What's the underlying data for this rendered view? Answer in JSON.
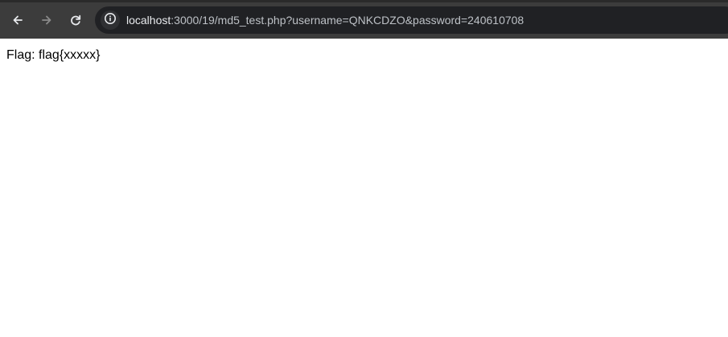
{
  "browser": {
    "back_icon": "arrow-left-icon",
    "forward_icon": "arrow-right-icon",
    "reload_icon": "reload-icon",
    "site_info_icon": "info-icon",
    "url_host": "localhost",
    "url_path": ":3000/19/md5_test.php?username=QNKCDZO&password=240610708"
  },
  "page": {
    "text": "Flag: flag{xxxxx}"
  },
  "colors": {
    "toolbar": "#3c3c3c",
    "omnibox": "#202124",
    "page_background": "#ffffff"
  }
}
